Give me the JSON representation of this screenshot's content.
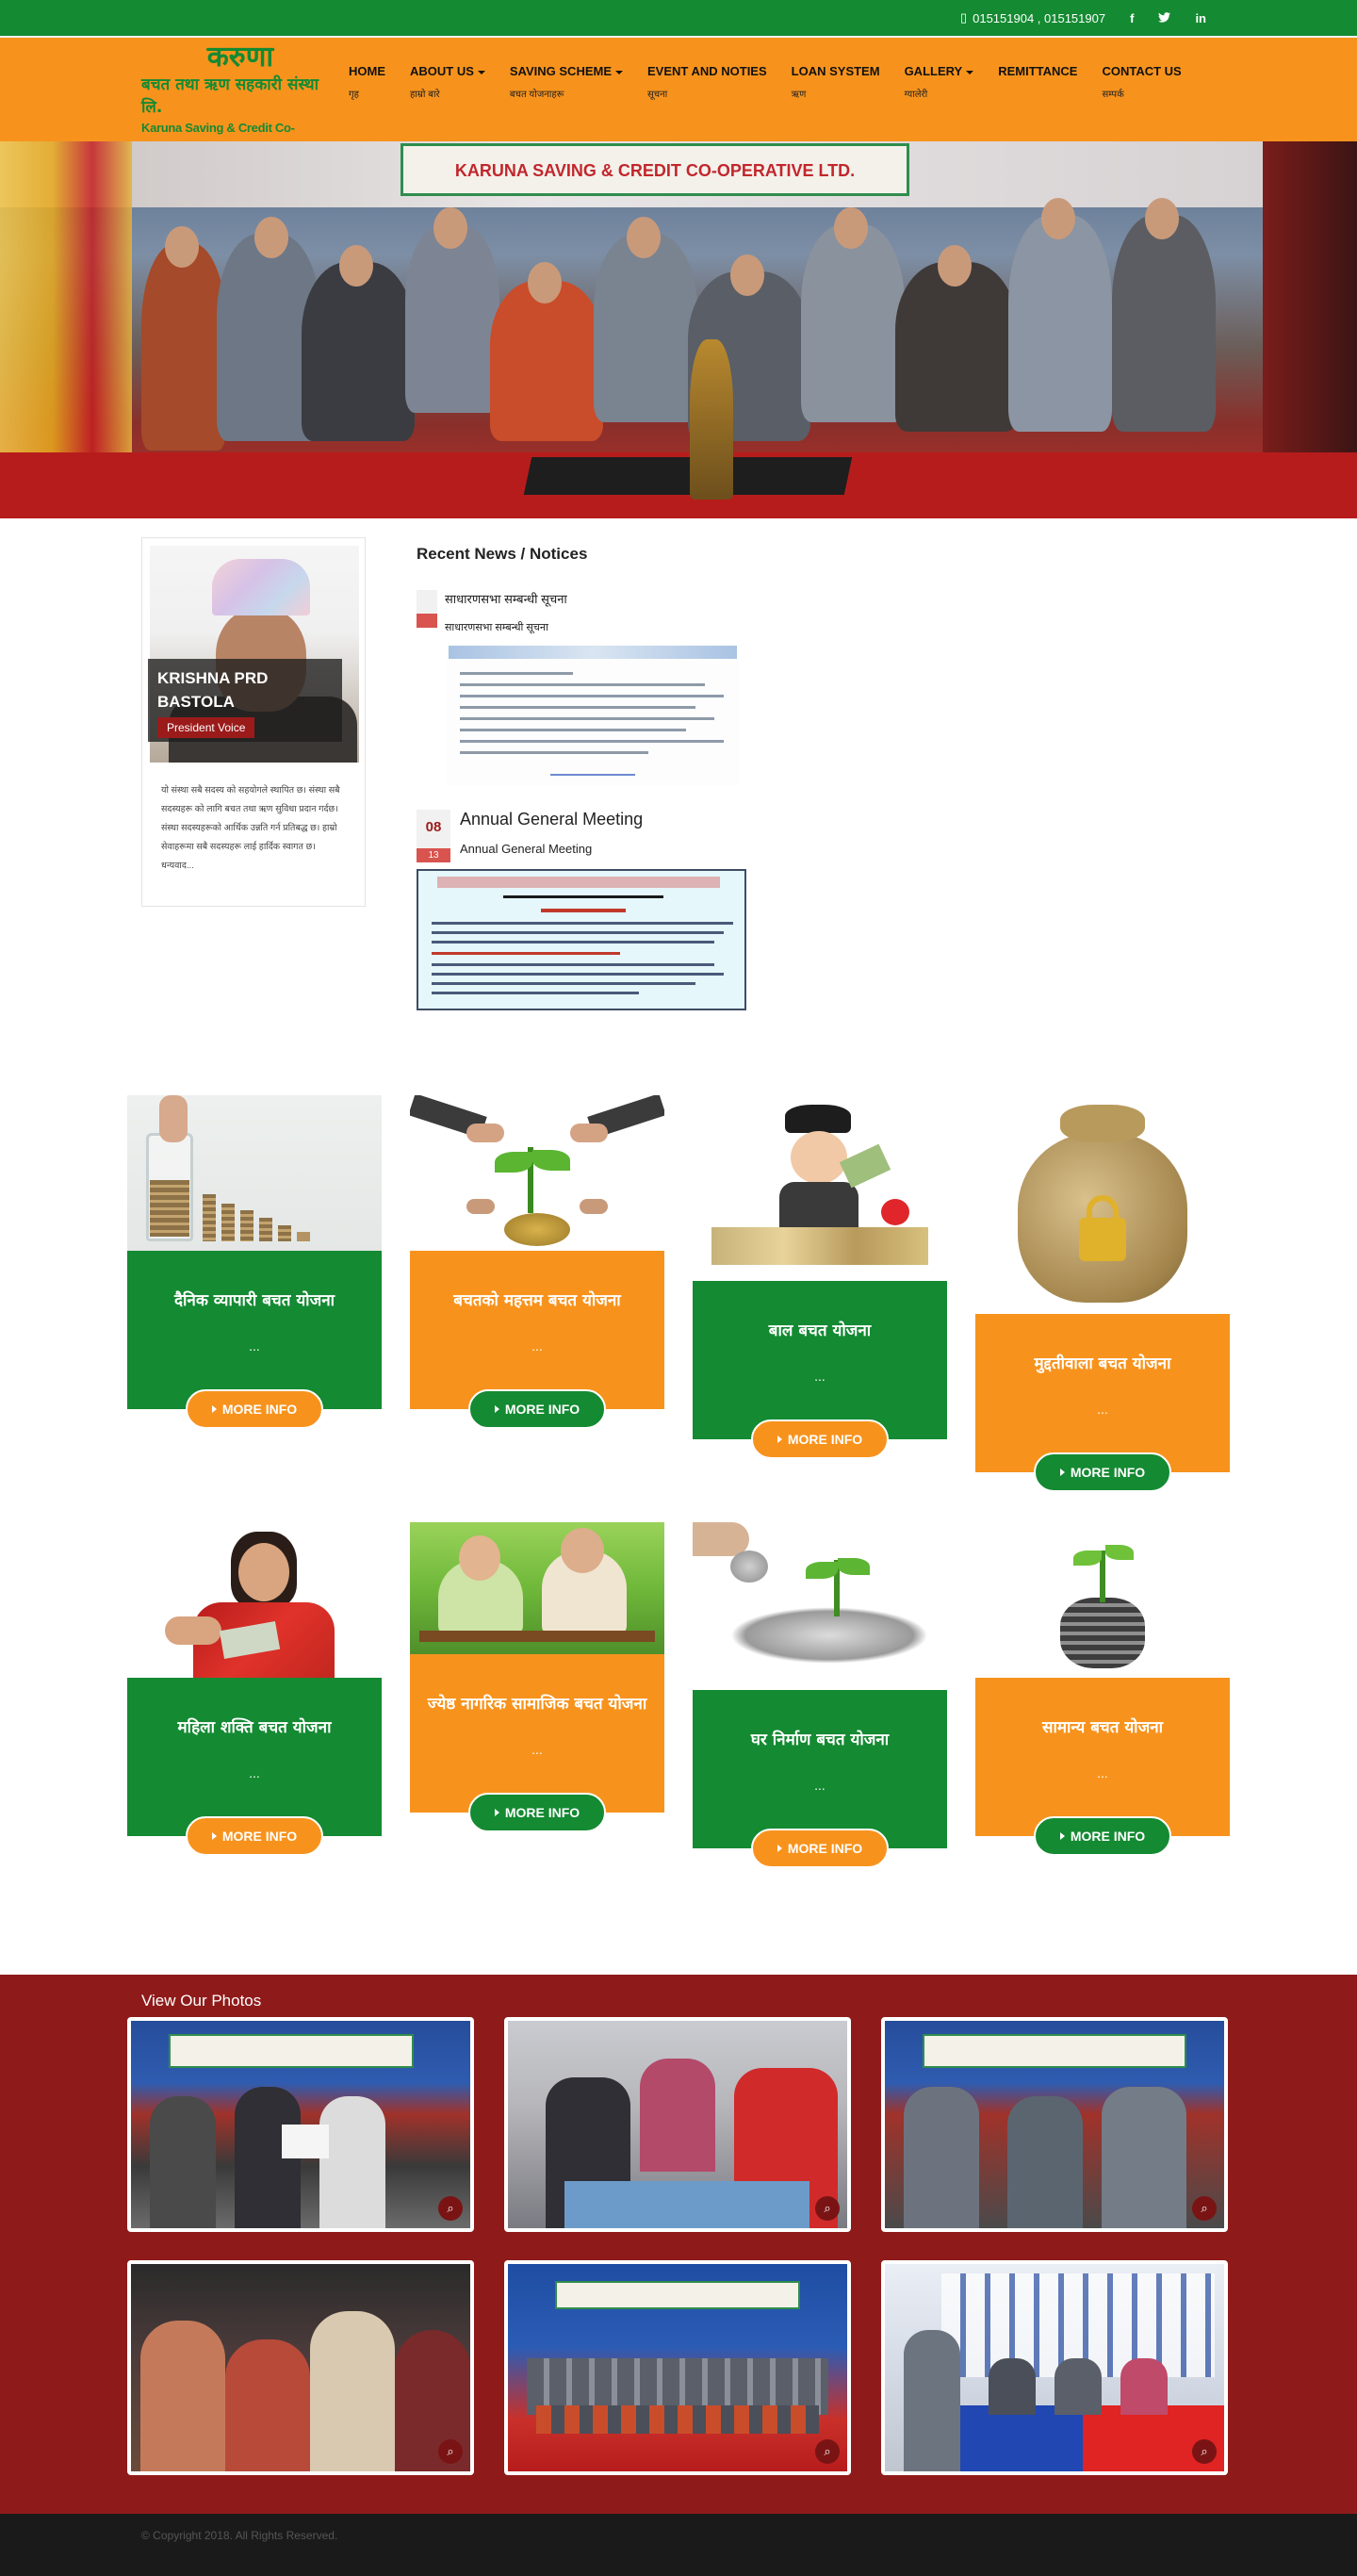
{
  "topbar": {
    "phone": "015151904 , 015151907",
    "social": [
      "f",
      "t",
      "in"
    ]
  },
  "logo": {
    "line1": "करुणा",
    "line2": "बचत तथा ऋण सहकारी संस्था लि.",
    "line3": "Karuna Saving & Credit Co-operative Ltd."
  },
  "nav": [
    {
      "en": "HOME",
      "np": "गृह",
      "caret": false
    },
    {
      "en": "ABOUT US",
      "np": "हाम्रो बारे",
      "caret": true
    },
    {
      "en": "SAVING SCHEME",
      "np": "बचत योजनाहरू",
      "caret": true
    },
    {
      "en": "EVENT AND NOTIES",
      "np": "सूचना",
      "caret": false
    },
    {
      "en": "LOAN SYSTEM",
      "np": "ऋण",
      "caret": false
    },
    {
      "en": "GALLERY",
      "np": "ग्यालेरी",
      "caret": true
    },
    {
      "en": "REMITTANCE",
      "np": "",
      "caret": false
    },
    {
      "en": "CONTACT US",
      "np": "सम्पर्क",
      "caret": false
    }
  ],
  "banner": {
    "sign_text": "KARUNA SAVING & CREDIT CO-OPERATIVE LTD."
  },
  "president": {
    "name": "KRISHNA PRD BASTOLA",
    "tag": "President Voice",
    "message": "यो संस्था सबै सदस्य को सहयोगले स्थापित छ। संस्था सबै सदस्यहरू को लागि बचत तथा ऋण सुविधा प्रदान गर्दछ। संस्था सदस्यहरूको आर्थिक उन्नति गर्न प्रतिबद्ध छ। हाम्रो सेवाहरूमा सबै सदस्यहरू लाई हार्दिक स्वागत छ। धन्यवाद..."
  },
  "news": {
    "heading": "Recent News / Notices",
    "items": [
      {
        "day": "",
        "month": "",
        "title": "साधारणसभा सम्बन्धी सूचना",
        "subtitle": "साधारणसभा सम्बन्धी सूचना"
      },
      {
        "day": "08",
        "month": "13",
        "title": "Annual General Meeting",
        "subtitle": "Annual General Meeting"
      }
    ]
  },
  "services": [
    {
      "title": "दैनिक व्यापारी बचत योजना",
      "dots": "...",
      "button": "MORE INFO",
      "theme": "green",
      "img": "coins-jar"
    },
    {
      "title": "बचतको महत्तम बचत योजना",
      "dots": "...",
      "button": "MORE INFO",
      "theme": "orange",
      "img": "plant-hands"
    },
    {
      "title": "बाल बचत योजना",
      "dots": "...",
      "button": "MORE INFO",
      "theme": "green",
      "img": "child-money"
    },
    {
      "title": "मुद्दतीवाला बचत योजना",
      "dots": "...",
      "button": "MORE INFO",
      "theme": "orange",
      "img": "money-bag"
    },
    {
      "title": "महिला शक्ति बचत योजना",
      "dots": "...",
      "button": "MORE INFO",
      "theme": "green",
      "img": "woman-money"
    },
    {
      "title": "ज्येष्ठ नागरिक सामाजिक बचत योजना",
      "dots": "...",
      "button": "MORE INFO",
      "theme": "orange",
      "img": "elders-park"
    },
    {
      "title": "घर निर्माण बचत योजना",
      "dots": "...",
      "button": "MORE INFO",
      "theme": "green",
      "img": "coins-plant"
    },
    {
      "title": "सामान्य बचत योजना",
      "dots": "...",
      "button": "MORE INFO",
      "theme": "orange",
      "img": "coin-stack"
    }
  ],
  "gallery": {
    "heading": "View Our Photos",
    "photos": [
      "award-ceremony",
      "registration-desk",
      "handshake-award",
      "audience-seated",
      "group-photo",
      "panel-table"
    ]
  },
  "footer": {
    "copyright": "© Copyright 2018. All Rights Reserved."
  },
  "colors": {
    "green": "#148a32",
    "orange": "#f7931d",
    "maroon": "#8f1a1a"
  }
}
